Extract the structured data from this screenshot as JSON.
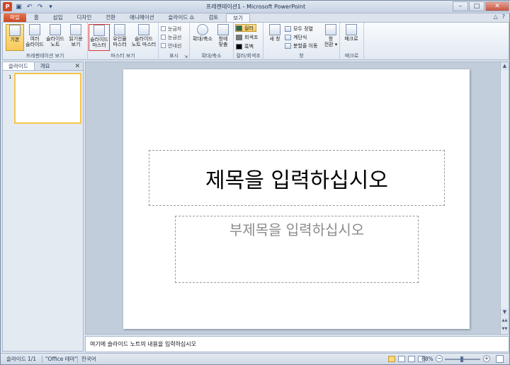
{
  "window": {
    "title": "프레젠테이션1 - Microsoft PowerPoint",
    "app_icon_letter": "P",
    "qat": [
      "save-icon",
      "undo-icon",
      "redo-icon",
      "customize-icon"
    ],
    "controls": {
      "minimize": "–",
      "maximize": "□",
      "close": "✕"
    }
  },
  "tabs": [
    {
      "label": "파일",
      "kind": "file"
    },
    {
      "label": "홈"
    },
    {
      "label": "삽입"
    },
    {
      "label": "디자인"
    },
    {
      "label": "전환"
    },
    {
      "label": "애니메이션"
    },
    {
      "label": "슬라이드 쇼"
    },
    {
      "label": "검토"
    },
    {
      "label": "보기",
      "active": true
    }
  ],
  "tab_right": {
    "minimize_ribbon": "△",
    "help": "?"
  },
  "ribbon": {
    "presentation_views": {
      "label": "프레젠테이션 보기",
      "buttons": [
        {
          "line1": "기본",
          "line2": ""
        },
        {
          "line1": "여러",
          "line2": "슬라이드"
        },
        {
          "line1": "슬라이드",
          "line2": "노트"
        },
        {
          "line1": "읽기용",
          "line2": "보기"
        }
      ]
    },
    "master_views": {
      "label": "마스터 보기",
      "buttons": [
        {
          "line1": "슬라이드",
          "line2": "마스터"
        },
        {
          "line1": "유인물",
          "line2": "마스터"
        },
        {
          "line1": "슬라이드",
          "line2": "노트 마스터"
        }
      ]
    },
    "show": {
      "label": "표시",
      "items": [
        "눈금자",
        "눈금선",
        "안내선"
      ],
      "launcher": "⇲"
    },
    "zoom": {
      "label": "확대/축소",
      "buttons": [
        {
          "line1": "확대/축소",
          "line2": ""
        },
        {
          "line1": "창에",
          "line2": "맞춤"
        }
      ]
    },
    "color": {
      "label": "컬러/회색조",
      "items": [
        {
          "label": "컬러",
          "color": "#2f6b3a"
        },
        {
          "label": "회색조",
          "color": "#7a7a7a"
        },
        {
          "label": "흑백",
          "color": "#000000"
        }
      ]
    },
    "window": {
      "label": "창",
      "new_window": "새 창",
      "items": [
        "모두 정렬",
        "계단식",
        "분할줄 이동"
      ],
      "switch_line1": "창",
      "switch_line2": "전환 ▾"
    },
    "macros": {
      "label": "매크로",
      "button": "매크로"
    }
  },
  "left_pane": {
    "tabs": [
      "슬라이드",
      "개요"
    ],
    "close": "✕",
    "slide_number": "1"
  },
  "slide": {
    "title_placeholder": "제목을 입력하십시오",
    "subtitle_placeholder": "부제목을 입력하십시오"
  },
  "notes": {
    "placeholder": "여기에 슬라이드 노트의 내용을 입력하십시오"
  },
  "status": {
    "slide_info": "슬라이드 1/1",
    "theme": "\"Office 테마\"",
    "language": "한국어",
    "zoom_percent": "88%",
    "zoom_level": 0.47,
    "minus": "−",
    "plus": "+"
  },
  "scroll": {
    "up": "▲",
    "down": "▼",
    "prev": "▲▲",
    "next": "▼▼"
  }
}
